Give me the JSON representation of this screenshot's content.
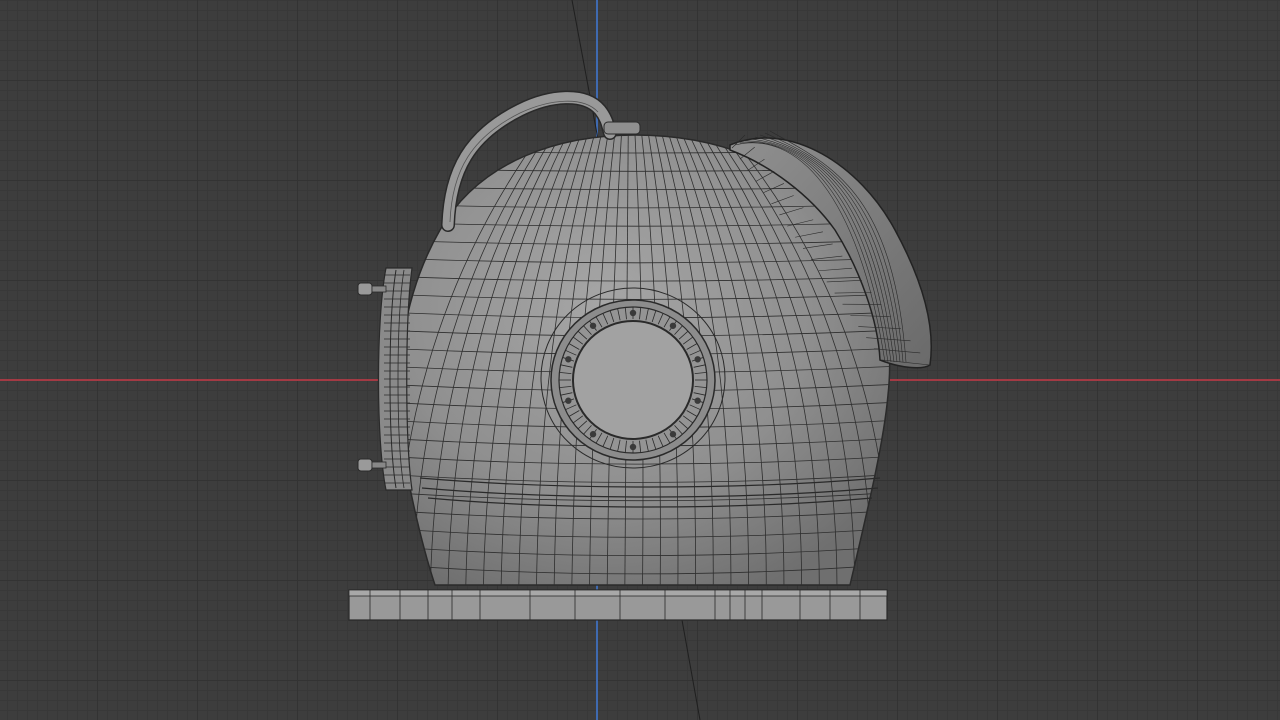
{
  "viewport": {
    "mode": "wireframe-overlay",
    "background_color": "#3d3d3d",
    "grid_color": "#333333"
  },
  "axes": {
    "x_color": "#a33a44",
    "y_color": "#3f6ab0"
  },
  "model": {
    "object": "diving-helmet",
    "parts": [
      "helmet-dome",
      "front-porthole",
      "side-ring",
      "top-handle",
      "air-hose",
      "bolt-studs",
      "base-plate"
    ],
    "shade_color": "#8f8f8f",
    "wire_color": "#2a2a2a"
  }
}
